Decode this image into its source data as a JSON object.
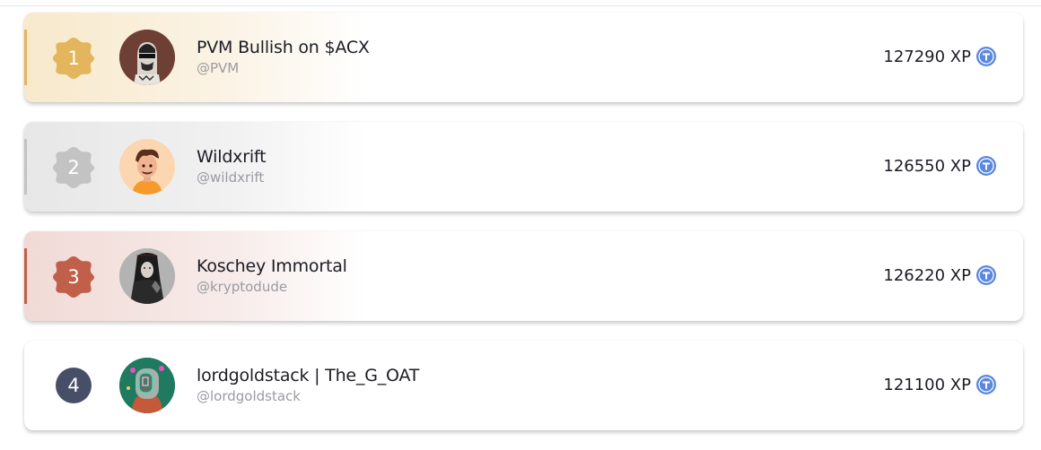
{
  "colors": {
    "gold": "#e3b55c",
    "silver": "#c3c3c3",
    "bronze": "#c0604a",
    "default_badge": "#474f68",
    "token": "#5b87e0"
  },
  "leaderboard": {
    "rows": [
      {
        "rank": "1",
        "name": "PVM Bullish on $ACX",
        "handle": "@PVM",
        "xp": "127290 XP",
        "avatar": "ape-avatar",
        "icon": "token-icon"
      },
      {
        "rank": "2",
        "name": "Wildxrift",
        "handle": "@wildxrift",
        "xp": "126550 XP",
        "avatar": "cartoon-person-avatar",
        "icon": "token-icon"
      },
      {
        "rank": "3",
        "name": "Koschey Immortal",
        "handle": "@kryptodude",
        "xp": "126220 XP",
        "avatar": "dark-figure-avatar",
        "icon": "token-icon"
      },
      {
        "rank": "4",
        "name": "lordgoldstack | The_G_OAT",
        "handle": "@lordgoldstack",
        "xp": "121100 XP",
        "avatar": "astronaut-avatar",
        "icon": "token-icon"
      }
    ]
  }
}
